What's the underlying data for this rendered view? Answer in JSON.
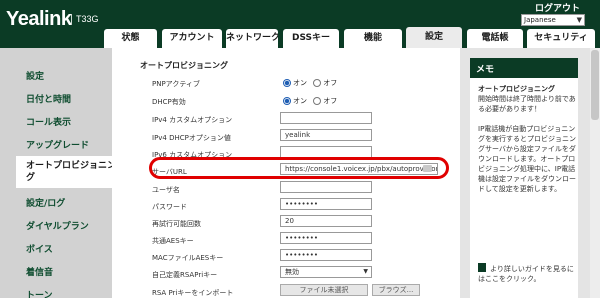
{
  "header": {
    "logo": "Yealink",
    "model": "T33G",
    "logout": "ログアウト",
    "language": "Japanese"
  },
  "tabs": [
    "状態",
    "アカウント",
    "ネットワーク",
    "DSSキー",
    "機能",
    "設定",
    "電話帳",
    "セキュリティ"
  ],
  "sidebar": {
    "items": [
      "設定",
      "日付と時間",
      "コール表示",
      "アップグレード",
      "オートプロビジョニング",
      "設定/ログ",
      "ダイヤルプラン",
      "ボイス",
      "着信音",
      "トーン"
    ],
    "active": "オートプロビジョニング"
  },
  "main": {
    "section_title": "オートプロビジョニング",
    "rows": [
      {
        "label": "PNPアクティブ",
        "on": "オン",
        "off": "オフ"
      },
      {
        "label": "DHCP有効",
        "on": "オン",
        "off": "オフ"
      },
      {
        "label": "IPv4 カスタムオプション",
        "value": ""
      },
      {
        "label": "IPv4 DHCPオプション値",
        "value": "yealink"
      },
      {
        "label": "IPv6 カスタムオプション",
        "value": ""
      },
      {
        "label": "サーバURL",
        "value": "https://console1.voicex.jp/pbx/autoprovision/"
      },
      {
        "label": "ユーザ名",
        "value": ""
      },
      {
        "label": "パスワード",
        "value": "••••••••"
      },
      {
        "label": "再試行可能回数",
        "value": "20"
      },
      {
        "label": "共通AESキー",
        "value": "••••••••"
      },
      {
        "label": "MACファイルAESキー",
        "value": "••••••••"
      },
      {
        "label": "自己定義RSAPriキー",
        "value": "無効"
      },
      {
        "label": "RSA Priキーをインポート",
        "file": "ファイル未選択",
        "browse": "ブラウズ..."
      }
    ]
  },
  "memo": {
    "header": "メモ",
    "title": "オートプロビジョニング",
    "para1": "開始時間は終了時間より前である必要があります！",
    "para2": "IP電話機が自動プロビジョニングを実行するとプロビジョニングサーバから設定ファイルをダウンロードします。オートプロビジョニング処理中に、IP電話機は設定ファイルをダウンロードして設定を更新します。",
    "link": "より詳しいガイドを見るにはここをクリック。"
  }
}
